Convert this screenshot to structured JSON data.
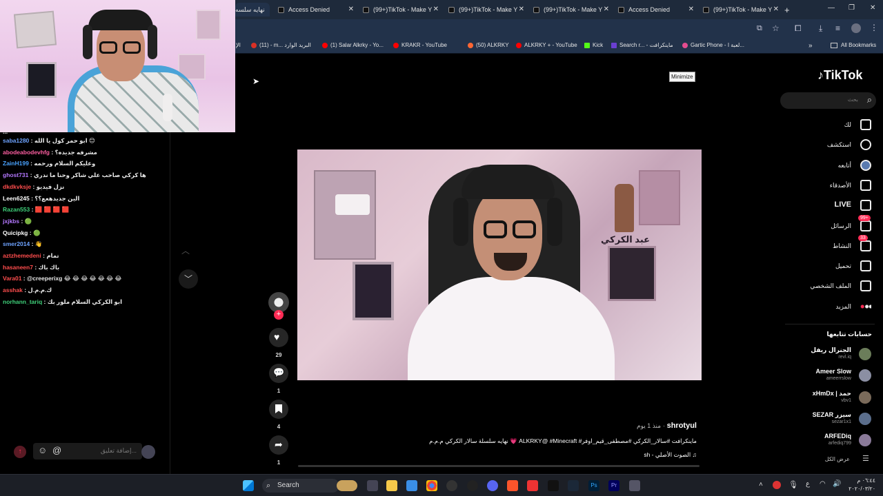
{
  "browser": {
    "tabs": [
      {
        "label": "نهايه سلسه"
      },
      {
        "label": "Access Denied"
      },
      {
        "label": "(99+)TikTok - Make Y"
      },
      {
        "label": "(99+)TikTok - Make Y"
      },
      {
        "label": "(99+)TikTok - Make Y"
      },
      {
        "label": "Access Denied"
      },
      {
        "label": "(99+)TikTok - Make Y"
      }
    ],
    "new_tab_icon": "+",
    "bookmarks": [
      {
        "label": "الإ"
      },
      {
        "label": "(11) - m... البريد الوارد",
        "color": "#d93025"
      },
      {
        "label": "(1) Salar Alkrky - Yo...",
        "color": "#ff0000"
      },
      {
        "label": "KRAKR - YouTube",
        "color": "#ff0000"
      },
      {
        "label": "(50) ALKRKY",
        "color": "#ff6633"
      },
      {
        "label": "ALKRKY + - YouTube",
        "color": "#ff0000"
      },
      {
        "label": "Kick",
        "color": "#53fc18"
      },
      {
        "label": "Search r... - ماينكرافت",
        "color": "#6a3fd1"
      },
      {
        "label": "Gartic Phone - لعبة ا...",
        "color": "#e34c8f"
      }
    ],
    "all_bookmarks": "All Bookmarks",
    "tooltip": "Minimize"
  },
  "chat": {
    "top_partial": "...",
    "messages": [
      {
        "user": "saba1280",
        "text": "ابو حمر كول يا الله 😊",
        "color": "#6ea3ff"
      },
      {
        "user": "abodeabodevhfg",
        "text": "مشرفه جديده؟",
        "color": "#ff5fa2"
      },
      {
        "user": "ZainH199",
        "text": "وعليكم السلام ورحمه",
        "color": "#4aa3ff"
      },
      {
        "user": "ghost731",
        "text": "ها كركي صاحب علي شاكر وحنا ما ندري",
        "color": "#b478ff"
      },
      {
        "user": "dkdkvksje",
        "text": "نزل فيديو",
        "color": "#ff4d4d"
      },
      {
        "user": "Leen6245",
        "text": "الين جديدهعع؟؟",
        "color": "#ffffff"
      },
      {
        "user": "Razan553",
        "text": "🟥 🟥 🟥 🟥",
        "color": "#3fd17a"
      },
      {
        "user": "jxjkbs",
        "text": "🟢",
        "color": "#b478ff"
      },
      {
        "user": "Quicipkg",
        "text": "🟢",
        "color": "#ffffff"
      },
      {
        "user": "smer2014",
        "text": "👋",
        "color": "#6ea3ff"
      },
      {
        "user": "aztzhemedeni",
        "text": "تمام",
        "color": "#ff4d4d"
      },
      {
        "user": "hasaneen7",
        "text": "باك باك",
        "color": "#ff4d4d"
      },
      {
        "user": "Vara01",
        "text": "@creeperixg 😂 😂 😂 😂 😂 😂 😂",
        "color": "#ff4d4d"
      },
      {
        "user": "asshak",
        "text": "ك.م.م.ل",
        "color": "#ff4d4d"
      },
      {
        "user": "norhann_tariq",
        "text": "ابو الكركي السلام ملور بك",
        "color": "#3fd17a"
      }
    ],
    "input_placeholder": "إضافة تعليق...",
    "mention_symbol": "@"
  },
  "tiktok": {
    "logo": "TikTok",
    "search_placeholder": "بحث",
    "nav": [
      {
        "label": "لك",
        "icon": "home-icon"
      },
      {
        "label": "استكشف",
        "icon": "compass-icon"
      },
      {
        "label": "أتابعه",
        "icon": "following-avatar-icon"
      },
      {
        "label": "الأصدقاء",
        "icon": "friends-icon"
      },
      {
        "label": "LIVE",
        "icon": "live-icon"
      },
      {
        "label": "الرسائل",
        "icon": "messages-icon",
        "badge": "99+"
      },
      {
        "label": "النشاط",
        "icon": "activity-icon",
        "badge": "33"
      },
      {
        "label": "تحميل",
        "icon": "upload-icon"
      },
      {
        "label": "الملف الشخصي",
        "icon": "profile-icon"
      },
      {
        "label": "المزيد",
        "icon": "more-icon"
      }
    ],
    "following_title": "حسابات تتابعها",
    "following": [
      {
        "name": "الجنرال ريفل",
        "handle": "revl.iq"
      },
      {
        "name": "Ameer Slow",
        "handle": "ameerrslow"
      },
      {
        "name": "xHmDx | حمد",
        "handle": "vbv1"
      },
      {
        "name": "SEZAR سيزر",
        "handle": "sezar1x1"
      },
      {
        "name": "ARFEDiq",
        "handle": "arfediq799"
      }
    ],
    "see_all": "عرض الكل",
    "actions": {
      "likes": "29",
      "comments": "1",
      "saves": "4",
      "shares": "1"
    },
    "post": {
      "author": "shrotyul",
      "time": "منذ 1 يوم",
      "caption": "نهايه سلسلة سالار الكركي م.م.م 💗 ALKRKY@ #Minecraft #ماينكرافت #سالار_الكركي #مصطفى_قيم_اوفر",
      "sound": "sh - الصوت الأصلي"
    },
    "video_overlay_text": "عبد الكركي"
  },
  "taskbar": {
    "search_label": "Search",
    "clock_time": "٠٦:٤٤ م",
    "clock_date": "٢٠٢٠/٠٣/٢٠",
    "lang": "ع"
  },
  "colors": {
    "accent": "#fe2c55",
    "chrome_bg": "#1e2a3b",
    "bar_bg": "#22324a"
  }
}
